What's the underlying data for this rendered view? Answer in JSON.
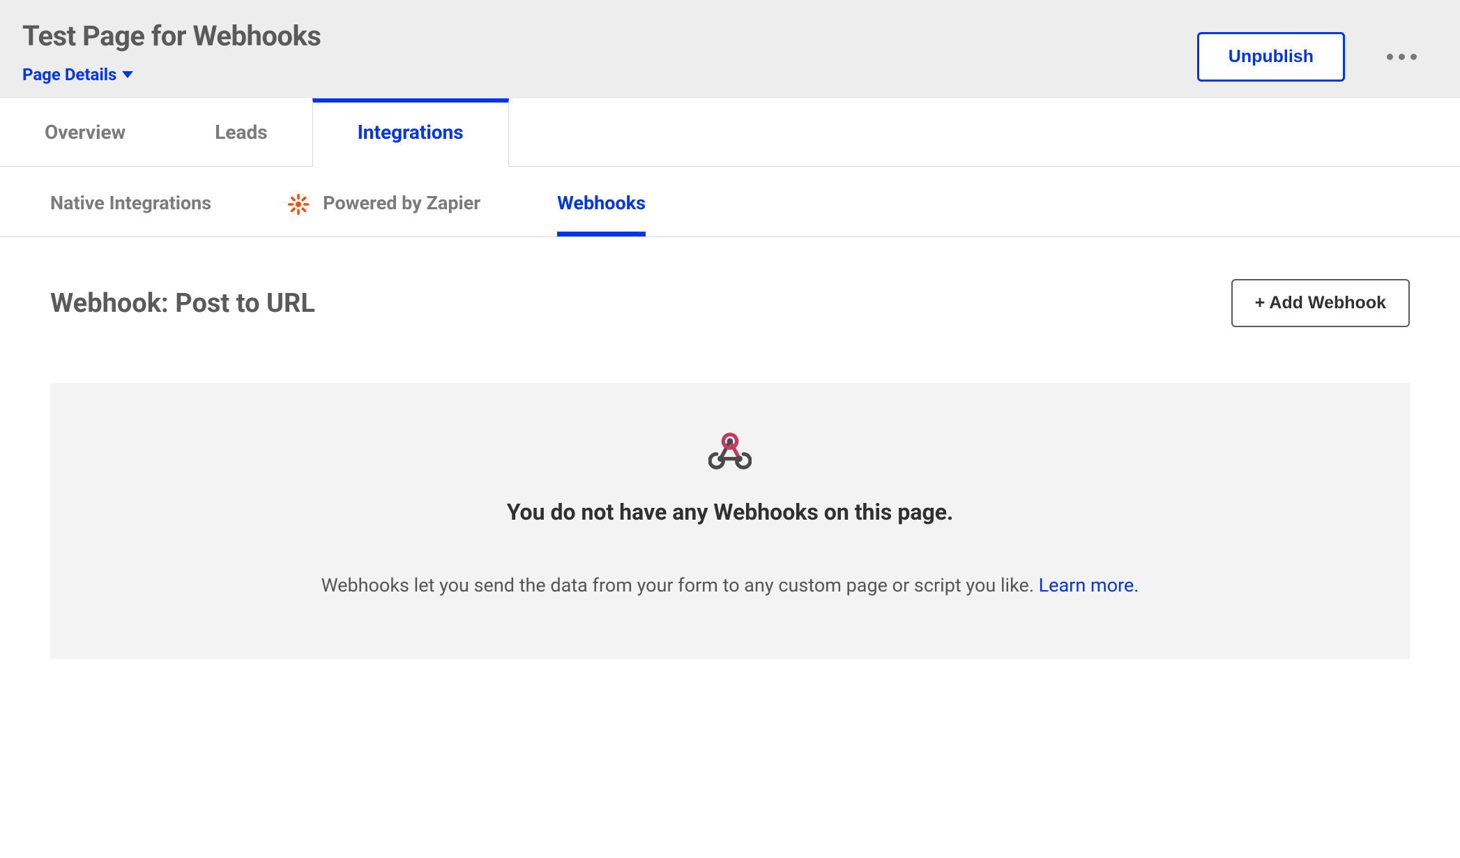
{
  "header": {
    "title": "Test Page for Webhooks",
    "details_label": "Page Details",
    "unpublish_label": "Unpublish"
  },
  "tabs": {
    "primary": [
      {
        "label": "Overview",
        "active": false
      },
      {
        "label": "Leads",
        "active": false
      },
      {
        "label": "Integrations",
        "active": true
      }
    ],
    "secondary": [
      {
        "label": "Native Integrations",
        "active": false
      },
      {
        "label": "Powered by Zapier",
        "active": false
      },
      {
        "label": "Webhooks",
        "active": true
      }
    ]
  },
  "section": {
    "title": "Webhook: Post to URL",
    "add_button": "+ Add Webhook"
  },
  "empty": {
    "heading": "You do not have any Webhooks on this page.",
    "description": "Webhooks let you send the data from your form to any custom page or script you like. ",
    "learn_more": "Learn more."
  },
  "colors": {
    "accent": "#0034ee",
    "muted_bg": "#ededed",
    "panel_bg": "#f3f3f3"
  }
}
